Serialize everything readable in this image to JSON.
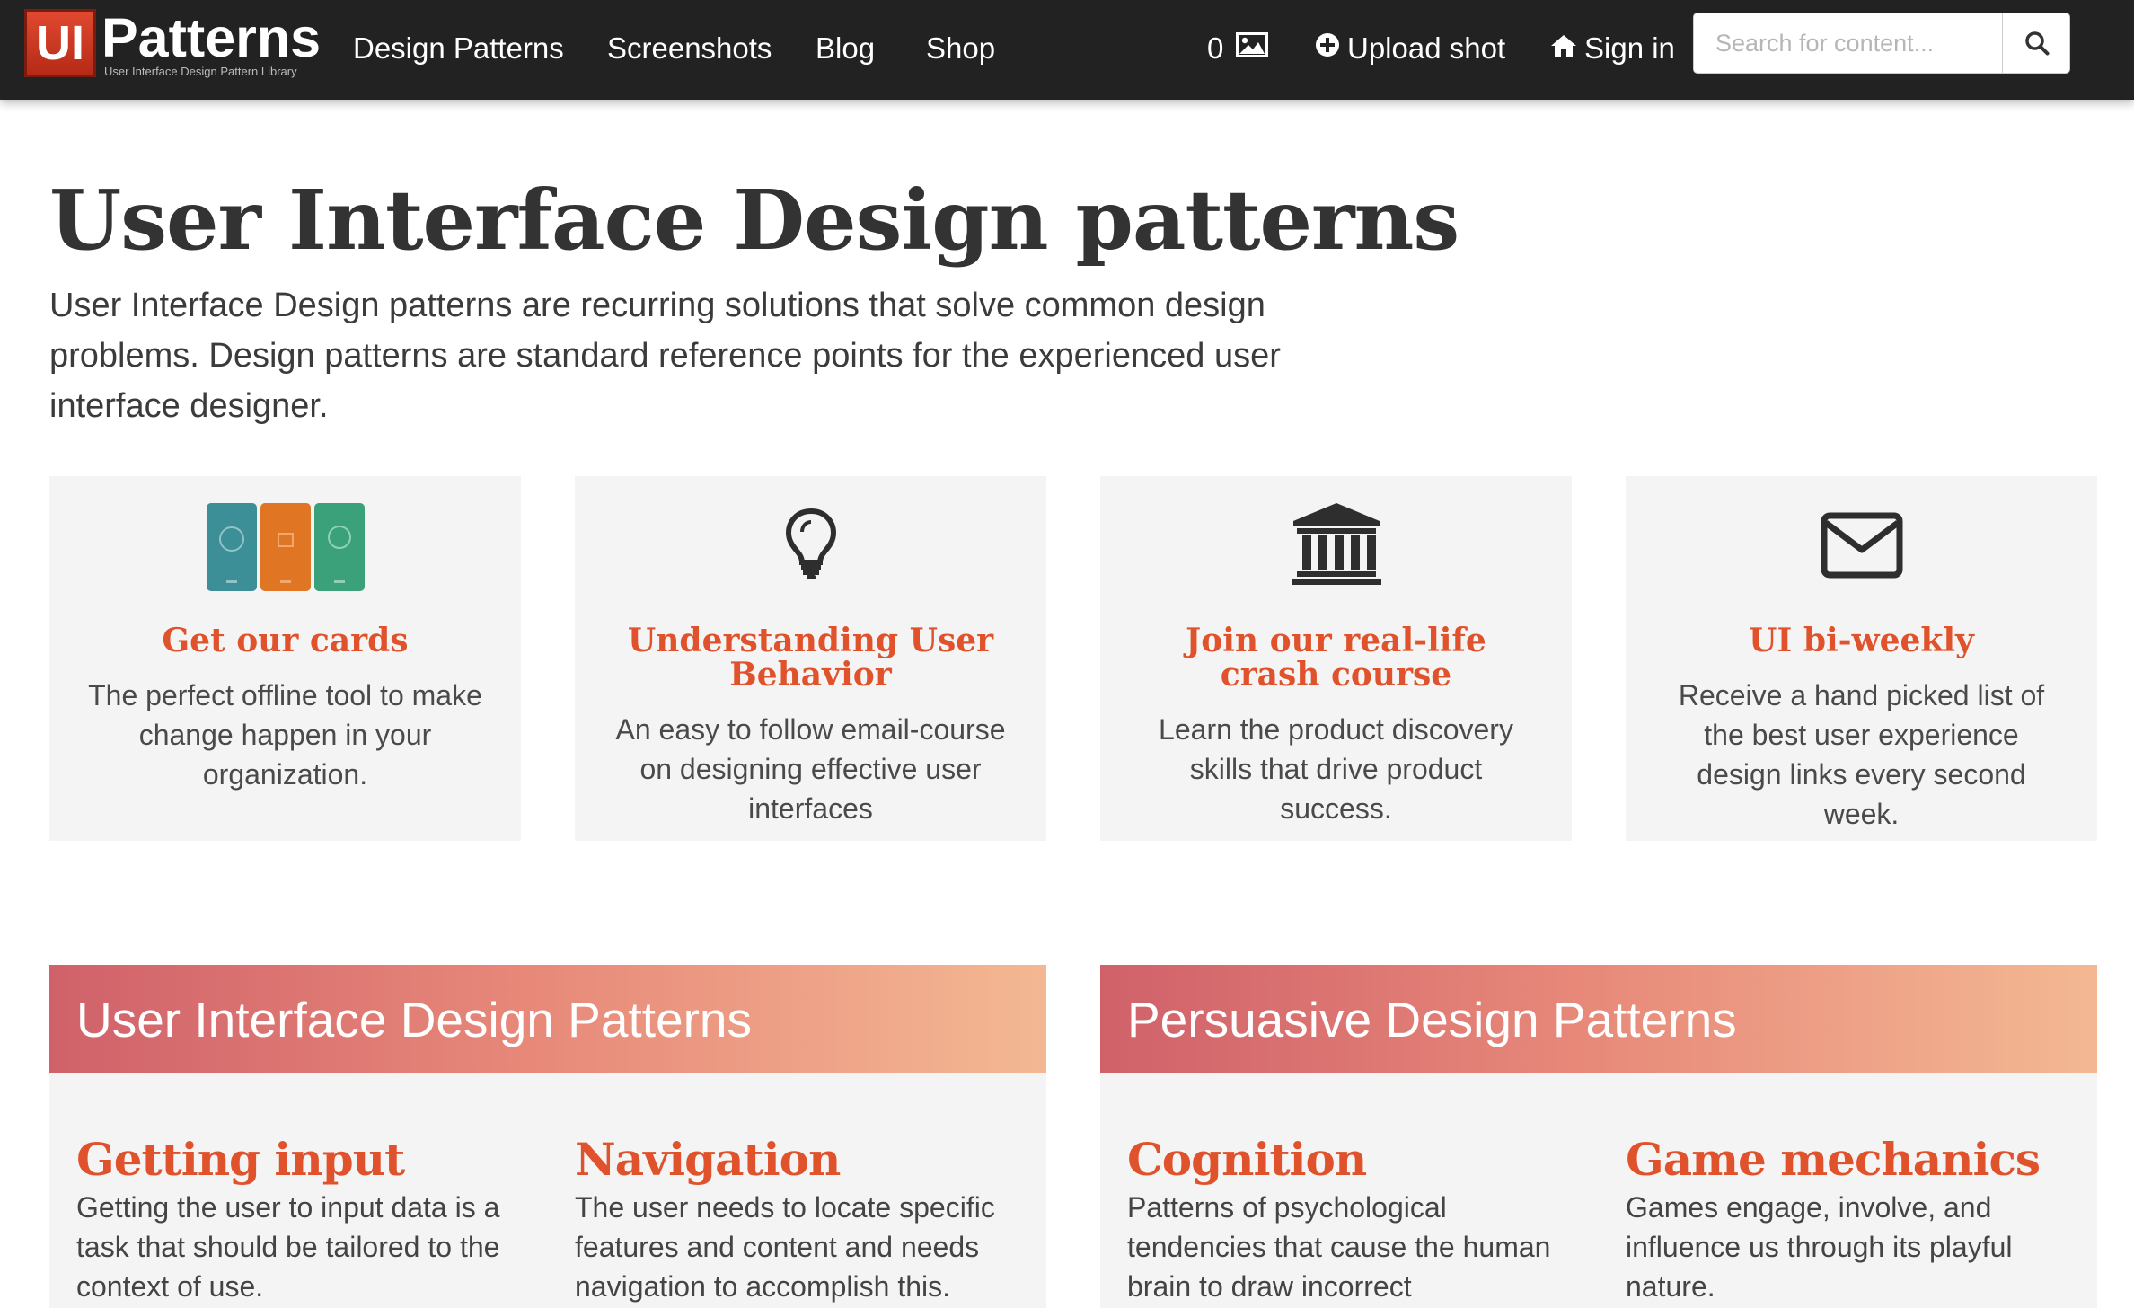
{
  "header": {
    "logo_ui": "UI",
    "logo_word": "Patterns",
    "logo_tagline": "User Interface Design Pattern Library",
    "nav": [
      {
        "label": "Design Patterns"
      },
      {
        "label": "Screenshots"
      },
      {
        "label": "Blog"
      },
      {
        "label": "Shop"
      }
    ],
    "shots_count": "0",
    "upload_label": "Upload shot",
    "signin_label": "Sign in",
    "search_placeholder": "Search for content..."
  },
  "hero": {
    "title": "User Interface Design patterns",
    "intro": "User Interface Design patterns are recurring solutions that solve common design problems. Design patterns are standard reference points for the experienced user interface designer."
  },
  "cards": [
    {
      "icon": "cards-image",
      "title": "Get our cards",
      "description": "The perfect offline tool to make change happen in your organization."
    },
    {
      "icon": "lightbulb-icon",
      "title": "Understanding User Behavior",
      "description": "An easy to follow email-course on designing effective user interfaces"
    },
    {
      "icon": "institution-icon",
      "title": "Join our real-life crash course",
      "description": "Learn the product discovery skills that drive product success."
    },
    {
      "icon": "envelope-icon",
      "title": "UI bi-weekly",
      "description": "Receive a hand picked list of the best user experience design links every second week."
    }
  ],
  "sections": [
    {
      "title": "User Interface Design Patterns",
      "patterns": [
        {
          "title": "Getting input",
          "description": "Getting the user to input data is a task that should be tailored to the context of use."
        },
        {
          "title": "Navigation",
          "description": "The user needs to locate specific features and content and needs navigation to accomplish this."
        }
      ]
    },
    {
      "title": "Persuasive Design Patterns",
      "patterns": [
        {
          "title": "Cognition",
          "description": "Patterns of psychological tendencies that cause the human brain to draw incorrect conclusions."
        },
        {
          "title": "Game mechanics",
          "description": "Games engage, involve, and influence us through its playful nature."
        }
      ]
    }
  ],
  "colors": {
    "topbar": "#222222",
    "accent": "#e0522b",
    "card_bg": "#f4f4f4",
    "gradient_start": "#d0616a",
    "gradient_end": "#f3b893"
  }
}
